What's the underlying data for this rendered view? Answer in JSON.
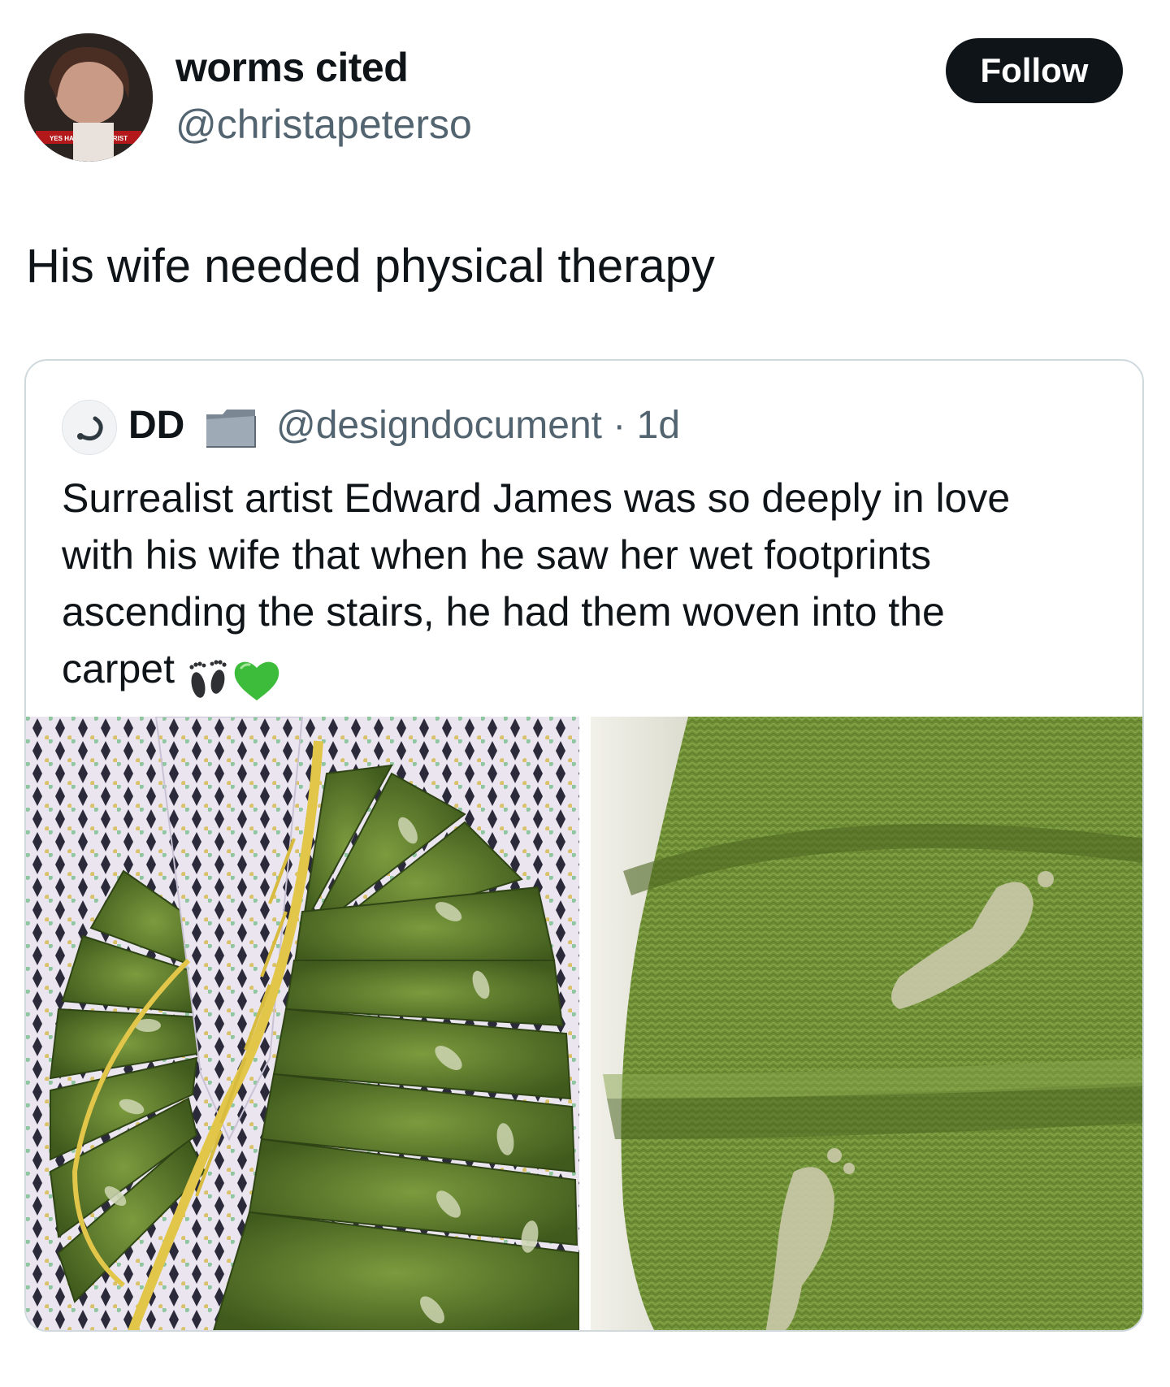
{
  "author": {
    "display_name": "worms cited",
    "handle": "@christapeterso",
    "avatar_badge_text": "YES HAMAS TERRORIST"
  },
  "follow_button": {
    "label": "Follow"
  },
  "tweet": {
    "text": "His wife needed physical therapy"
  },
  "quoted_tweet": {
    "display_name": "DD",
    "name_icon": "folder-icon",
    "meta": "@designdocument · 1d",
    "text_lines": [
      "Surrealist artist Edward James was so deeply in love",
      "with his wife that when he saw her wet footprints",
      "ascending the stairs, he had them woven into the",
      "carpet"
    ],
    "emojis": [
      "footprints-icon",
      "green-heart-icon"
    ],
    "media": [
      {
        "name": "spiral-staircase-photo"
      },
      {
        "name": "carpet-footprints-closeup-photo"
      }
    ]
  },
  "colors": {
    "text_primary": "#0f1419",
    "text_secondary": "#536471",
    "follow_bg": "#0f1419",
    "card_border": "#cfd9de",
    "carpet_green": "#6f8f36",
    "heart_green": "#3dbb3a"
  }
}
